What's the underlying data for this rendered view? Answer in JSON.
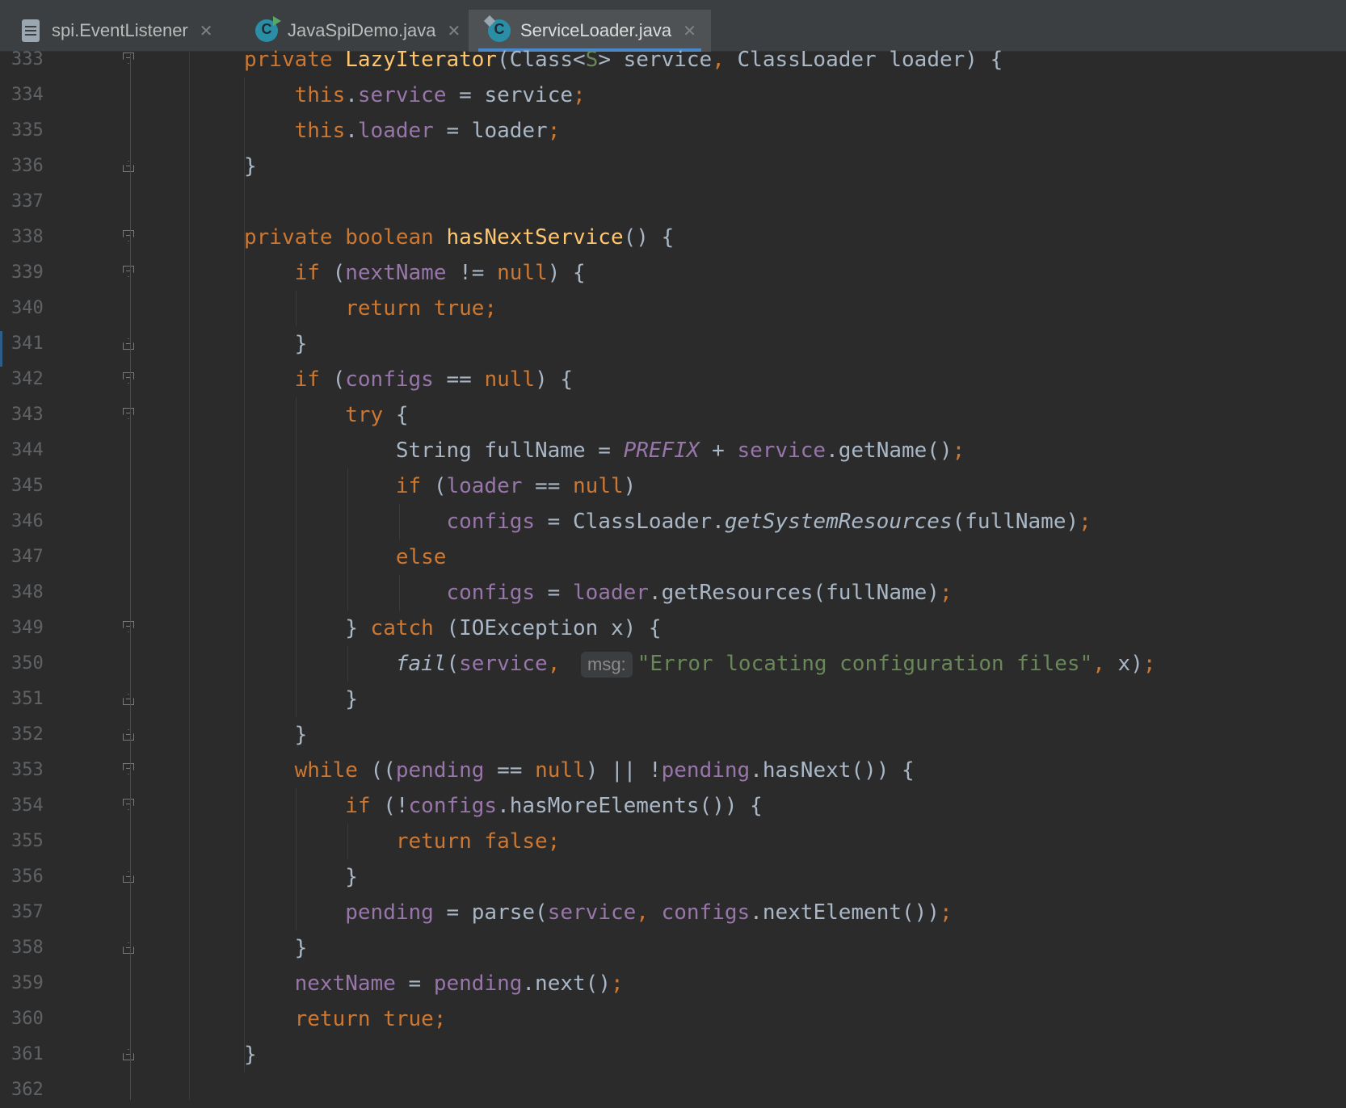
{
  "tabs": [
    {
      "label": "spi.EventListener",
      "icon": "file-icon",
      "active": false
    },
    {
      "label": "JavaSpiDemo.java",
      "icon": "java-class-runnable-icon",
      "active": false
    },
    {
      "label": "ServiceLoader.java",
      "icon": "java-class-library-icon",
      "active": true
    }
  ],
  "editor": {
    "lines": [
      {
        "n": "333",
        "fold": "open"
      },
      {
        "n": "334",
        "fold": ""
      },
      {
        "n": "335",
        "fold": ""
      },
      {
        "n": "336",
        "fold": "close"
      },
      {
        "n": "337",
        "fold": ""
      },
      {
        "n": "338",
        "fold": "open"
      },
      {
        "n": "339",
        "fold": "open"
      },
      {
        "n": "340",
        "fold": ""
      },
      {
        "n": "341",
        "fold": "close"
      },
      {
        "n": "342",
        "fold": "open"
      },
      {
        "n": "343",
        "fold": "open"
      },
      {
        "n": "344",
        "fold": ""
      },
      {
        "n": "345",
        "fold": ""
      },
      {
        "n": "346",
        "fold": ""
      },
      {
        "n": "347",
        "fold": ""
      },
      {
        "n": "348",
        "fold": ""
      },
      {
        "n": "349",
        "fold": "open"
      },
      {
        "n": "350",
        "fold": ""
      },
      {
        "n": "351",
        "fold": "close"
      },
      {
        "n": "352",
        "fold": "close"
      },
      {
        "n": "353",
        "fold": "open"
      },
      {
        "n": "354",
        "fold": "open"
      },
      {
        "n": "355",
        "fold": ""
      },
      {
        "n": "356",
        "fold": "close"
      },
      {
        "n": "357",
        "fold": ""
      },
      {
        "n": "358",
        "fold": "close"
      },
      {
        "n": "359",
        "fold": ""
      },
      {
        "n": "360",
        "fold": ""
      },
      {
        "n": "361",
        "fold": "close"
      },
      {
        "n": "362",
        "fold": ""
      }
    ],
    "code": [
      [
        {
          "t": "private ",
          "c": "k"
        },
        {
          "t": "LazyIterator",
          "c": "m"
        },
        {
          "t": "(Class<",
          "c": "f"
        },
        {
          "t": "S",
          "c": "s"
        },
        {
          "t": "> service",
          "c": "f"
        },
        {
          "t": ", ",
          "c": "k"
        },
        {
          "t": "ClassLoader loader) {",
          "c": "f"
        }
      ],
      [
        {
          "t": "    "
        },
        {
          "t": "this",
          "c": "k"
        },
        {
          "t": "."
        },
        {
          "t": "service",
          "c": "v"
        },
        {
          "t": " = service"
        },
        {
          "t": ";",
          "c": "k"
        }
      ],
      [
        {
          "t": "    "
        },
        {
          "t": "this",
          "c": "k"
        },
        {
          "t": "."
        },
        {
          "t": "loader",
          "c": "v"
        },
        {
          "t": " = loader"
        },
        {
          "t": ";",
          "c": "k"
        }
      ],
      [
        {
          "t": "}"
        }
      ],
      [],
      [
        {
          "t": "private boolean ",
          "c": "k"
        },
        {
          "t": "hasNextService",
          "c": "m"
        },
        {
          "t": "() {"
        }
      ],
      [
        {
          "t": "    "
        },
        {
          "t": "if ",
          "c": "k"
        },
        {
          "t": "("
        },
        {
          "t": "nextName",
          "c": "v"
        },
        {
          "t": " != "
        },
        {
          "t": "null",
          "c": "k"
        },
        {
          "t": ") {"
        }
      ],
      [
        {
          "t": "        "
        },
        {
          "t": "return true;",
          "c": "k"
        }
      ],
      [
        {
          "t": "    }"
        }
      ],
      [
        {
          "t": "    "
        },
        {
          "t": "if ",
          "c": "k"
        },
        {
          "t": "("
        },
        {
          "t": "configs",
          "c": "v"
        },
        {
          "t": " == "
        },
        {
          "t": "null",
          "c": "k"
        },
        {
          "t": ") {"
        }
      ],
      [
        {
          "t": "        "
        },
        {
          "t": "try ",
          "c": "k"
        },
        {
          "t": "{"
        }
      ],
      [
        {
          "t": "            String fullName = "
        },
        {
          "t": "PREFIX",
          "c": "c"
        },
        {
          "t": " + "
        },
        {
          "t": "service",
          "c": "v"
        },
        {
          "t": ".getName()"
        },
        {
          "t": ";",
          "c": "k"
        }
      ],
      [
        {
          "t": "            "
        },
        {
          "t": "if ",
          "c": "k"
        },
        {
          "t": "("
        },
        {
          "t": "loader",
          "c": "v"
        },
        {
          "t": " == "
        },
        {
          "t": "null",
          "c": "k"
        },
        {
          "t": ")"
        }
      ],
      [
        {
          "t": "                "
        },
        {
          "t": "configs",
          "c": "v"
        },
        {
          "t": " = ClassLoader."
        },
        {
          "t": "getSystemResources",
          "c": "it"
        },
        {
          "t": "(fullName)"
        },
        {
          "t": ";",
          "c": "k"
        }
      ],
      [
        {
          "t": "            "
        },
        {
          "t": "else",
          "c": "k"
        }
      ],
      [
        {
          "t": "                "
        },
        {
          "t": "configs",
          "c": "v"
        },
        {
          "t": " = "
        },
        {
          "t": "loader",
          "c": "v"
        },
        {
          "t": ".getResources(fullName)"
        },
        {
          "t": ";",
          "c": "k"
        }
      ],
      [
        {
          "t": "        } "
        },
        {
          "t": "catch ",
          "c": "k"
        },
        {
          "t": "(IOException x) {"
        }
      ],
      [
        {
          "t": "            "
        },
        {
          "t": "fail",
          "c": "it"
        },
        {
          "t": "("
        },
        {
          "t": "service",
          "c": "v"
        },
        {
          "t": ", ",
          "c": "k"
        },
        {
          "hint": "msg:"
        },
        {
          "t": "\"Error locating configuration files\"",
          "c": "s"
        },
        {
          "t": ", ",
          "c": "k"
        },
        {
          "t": "x)"
        },
        {
          "t": ";",
          "c": "k"
        }
      ],
      [
        {
          "t": "        }"
        }
      ],
      [
        {
          "t": "    }"
        }
      ],
      [
        {
          "t": "    "
        },
        {
          "t": "while ",
          "c": "k"
        },
        {
          "t": "(("
        },
        {
          "t": "pending",
          "c": "v"
        },
        {
          "t": " == "
        },
        {
          "t": "null",
          "c": "k"
        },
        {
          "t": ") || !"
        },
        {
          "t": "pending",
          "c": "v"
        },
        {
          "t": ".hasNext()) {"
        }
      ],
      [
        {
          "t": "        "
        },
        {
          "t": "if ",
          "c": "k"
        },
        {
          "t": "(!"
        },
        {
          "t": "configs",
          "c": "v"
        },
        {
          "t": ".hasMoreElements()) {"
        }
      ],
      [
        {
          "t": "            "
        },
        {
          "t": "return false;",
          "c": "k"
        }
      ],
      [
        {
          "t": "        }"
        }
      ],
      [
        {
          "t": "        "
        },
        {
          "t": "pending",
          "c": "v"
        },
        {
          "t": " = parse("
        },
        {
          "t": "service",
          "c": "v"
        },
        {
          "t": ", ",
          "c": "k"
        },
        {
          "t": "configs",
          "c": "v"
        },
        {
          "t": ".nextElement())"
        },
        {
          "t": ";",
          "c": "k"
        }
      ],
      [
        {
          "t": "    }"
        }
      ],
      [
        {
          "t": "    "
        },
        {
          "t": "nextName",
          "c": "v"
        },
        {
          "t": " = "
        },
        {
          "t": "pending",
          "c": "v"
        },
        {
          "t": ".next()"
        },
        {
          "t": ";",
          "c": "k"
        }
      ],
      [
        {
          "t": "    "
        },
        {
          "t": "return true;",
          "c": "k"
        }
      ],
      [
        {
          "t": "}"
        }
      ],
      []
    ]
  }
}
